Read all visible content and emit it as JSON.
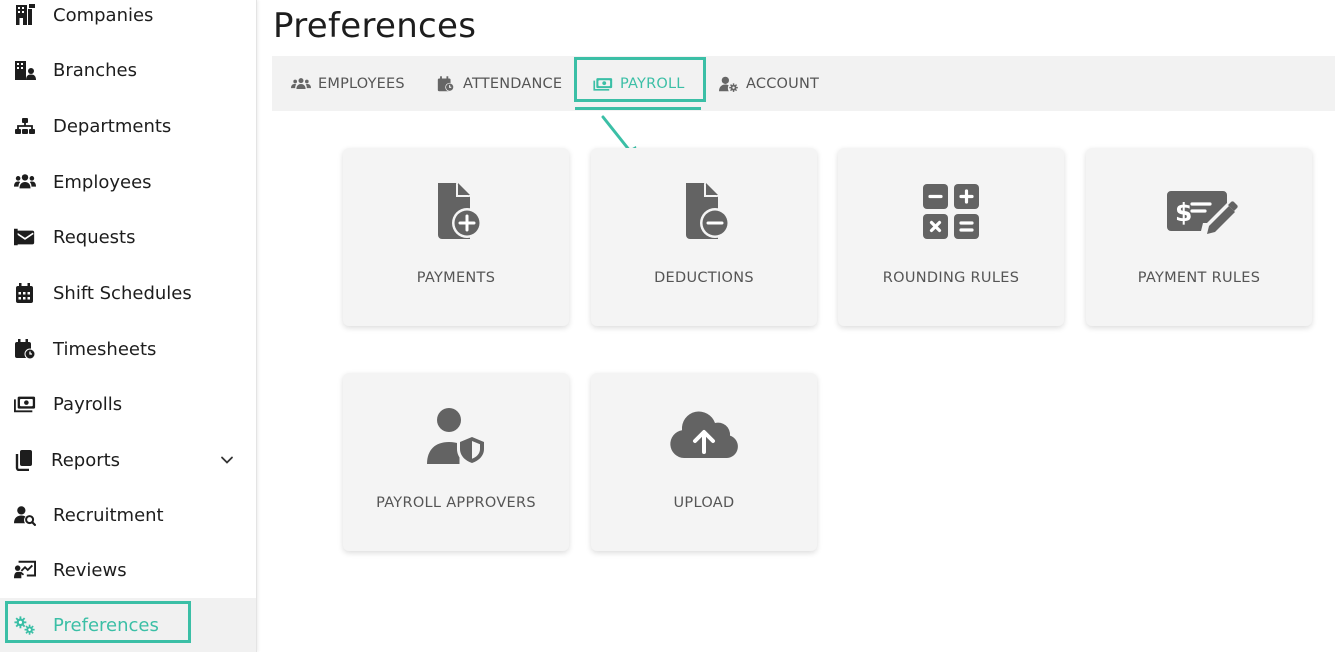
{
  "sidebar": {
    "items": [
      {
        "label": "Companies",
        "icon": "building-icon"
      },
      {
        "label": "Branches",
        "icon": "branches-icon"
      },
      {
        "label": "Departments",
        "icon": "sitemap-icon"
      },
      {
        "label": "Employees",
        "icon": "users-icon"
      },
      {
        "label": "Requests",
        "icon": "envelope-icon"
      },
      {
        "label": "Shift Schedules",
        "icon": "calendar-icon"
      },
      {
        "label": "Timesheets",
        "icon": "calendar-clock-icon"
      },
      {
        "label": "Payrolls",
        "icon": "money-bill-icon"
      },
      {
        "label": "Reports",
        "icon": "copy-icon"
      },
      {
        "label": "Recruitment",
        "icon": "user-search-icon"
      },
      {
        "label": "Reviews",
        "icon": "chalkboard-icon"
      },
      {
        "label": "Preferences",
        "icon": "cogs-icon"
      }
    ],
    "active": "Preferences"
  },
  "page": {
    "title": "Preferences"
  },
  "tabs": [
    {
      "label": "EMPLOYEES",
      "icon": "users-icon"
    },
    {
      "label": "ATTENDANCE",
      "icon": "calendar-clock-icon"
    },
    {
      "label": "PAYROLL",
      "icon": "money-bill-icon"
    },
    {
      "label": "ACCOUNT",
      "icon": "user-cog-icon"
    }
  ],
  "active_tab": "PAYROLL",
  "cards": [
    {
      "label": "PAYMENTS",
      "icon": "file-plus-icon"
    },
    {
      "label": "DEDUCTIONS",
      "icon": "file-minus-icon"
    },
    {
      "label": "ROUNDING RULES",
      "icon": "calculator-icon"
    },
    {
      "label": "PAYMENT RULES",
      "icon": "money-check-edit-icon"
    },
    {
      "label": "PAYROLL APPROVERS",
      "icon": "user-shield-icon"
    },
    {
      "label": "UPLOAD",
      "icon": "cloud-upload-icon"
    }
  ],
  "colors": {
    "accent": "#3bbfa6",
    "icon_gray": "#636363",
    "text": "#1d1d1d"
  }
}
